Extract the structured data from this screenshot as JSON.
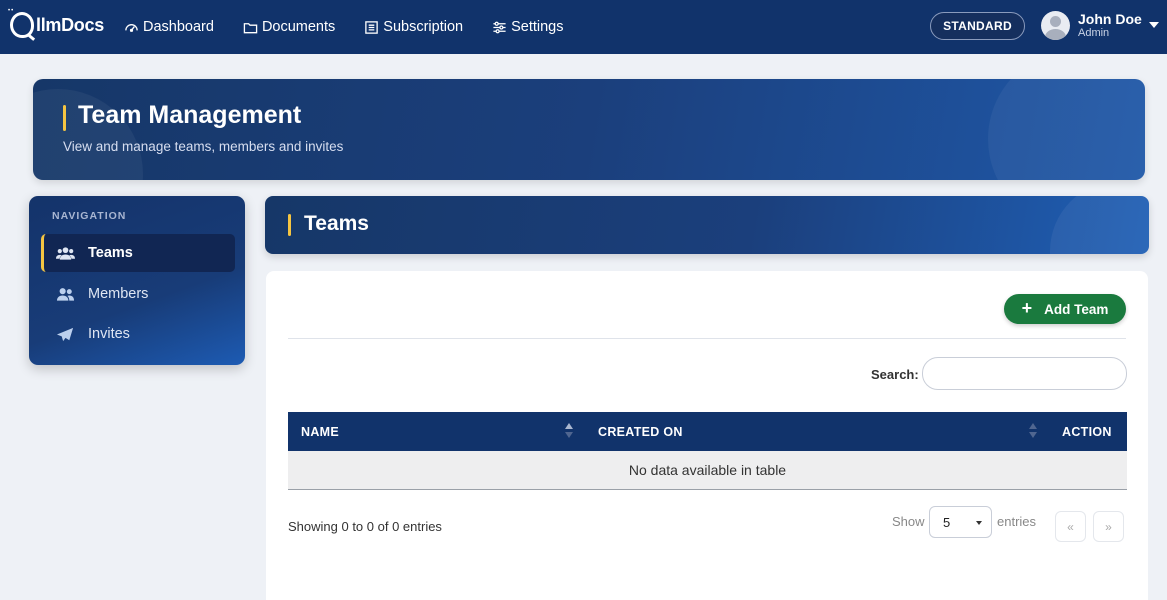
{
  "app": {
    "logo_text": "llmDocs",
    "logo_letter": "Q"
  },
  "nav": {
    "items": [
      {
        "label": "Dashboard",
        "icon": "gauge-icon"
      },
      {
        "label": "Documents",
        "icon": "folder-icon"
      },
      {
        "label": "Subscription",
        "icon": "list-icon"
      },
      {
        "label": "Settings",
        "icon": "sliders-icon"
      }
    ],
    "plan_badge": "STANDARD",
    "user": {
      "name": "John Doe",
      "role": "Admin"
    }
  },
  "hero": {
    "title": "Team Management",
    "subtitle": "View and manage teams, members and invites"
  },
  "sidebar": {
    "heading": "NAVIGATION",
    "items": [
      {
        "label": "Teams",
        "icon": "users-icon",
        "active": true
      },
      {
        "label": "Members",
        "icon": "user-group-icon",
        "active": false
      },
      {
        "label": "Invites",
        "icon": "paper-plane-icon",
        "active": false
      }
    ]
  },
  "section": {
    "title": "Teams"
  },
  "toolbar": {
    "add_label": "Add Team",
    "add_symbol": "+"
  },
  "search": {
    "label": "Search:",
    "value": "",
    "placeholder": ""
  },
  "table": {
    "columns": [
      "NAME",
      "CREATED ON",
      "ACTION"
    ],
    "empty_message": "No data available in table"
  },
  "footer": {
    "info": "Showing 0 to 0 of 0 entries",
    "show_label": "Show",
    "page_size": "5",
    "entries_label": "entries",
    "prev": "«",
    "next": "»"
  },
  "colors": {
    "primary_navy": "#11336b",
    "accent_yellow": "#f5c542",
    "success_green": "#1a7a3e",
    "page_bg": "#eef1f6"
  }
}
